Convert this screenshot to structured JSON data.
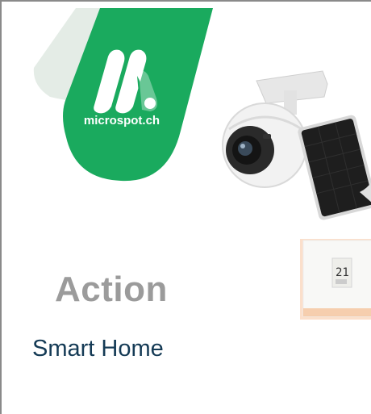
{
  "brand": {
    "name": "microspot.ch",
    "primary_color": "#1aaa5e",
    "secondary_color": "#e4ece6"
  },
  "promo": {
    "title": "Action",
    "subtitle": "Smart Home"
  },
  "products": {
    "camera_icon": "security-camera-with-solar-panel",
    "thermostat_icon": "smart-thermostat",
    "thermostat_display": "21"
  }
}
